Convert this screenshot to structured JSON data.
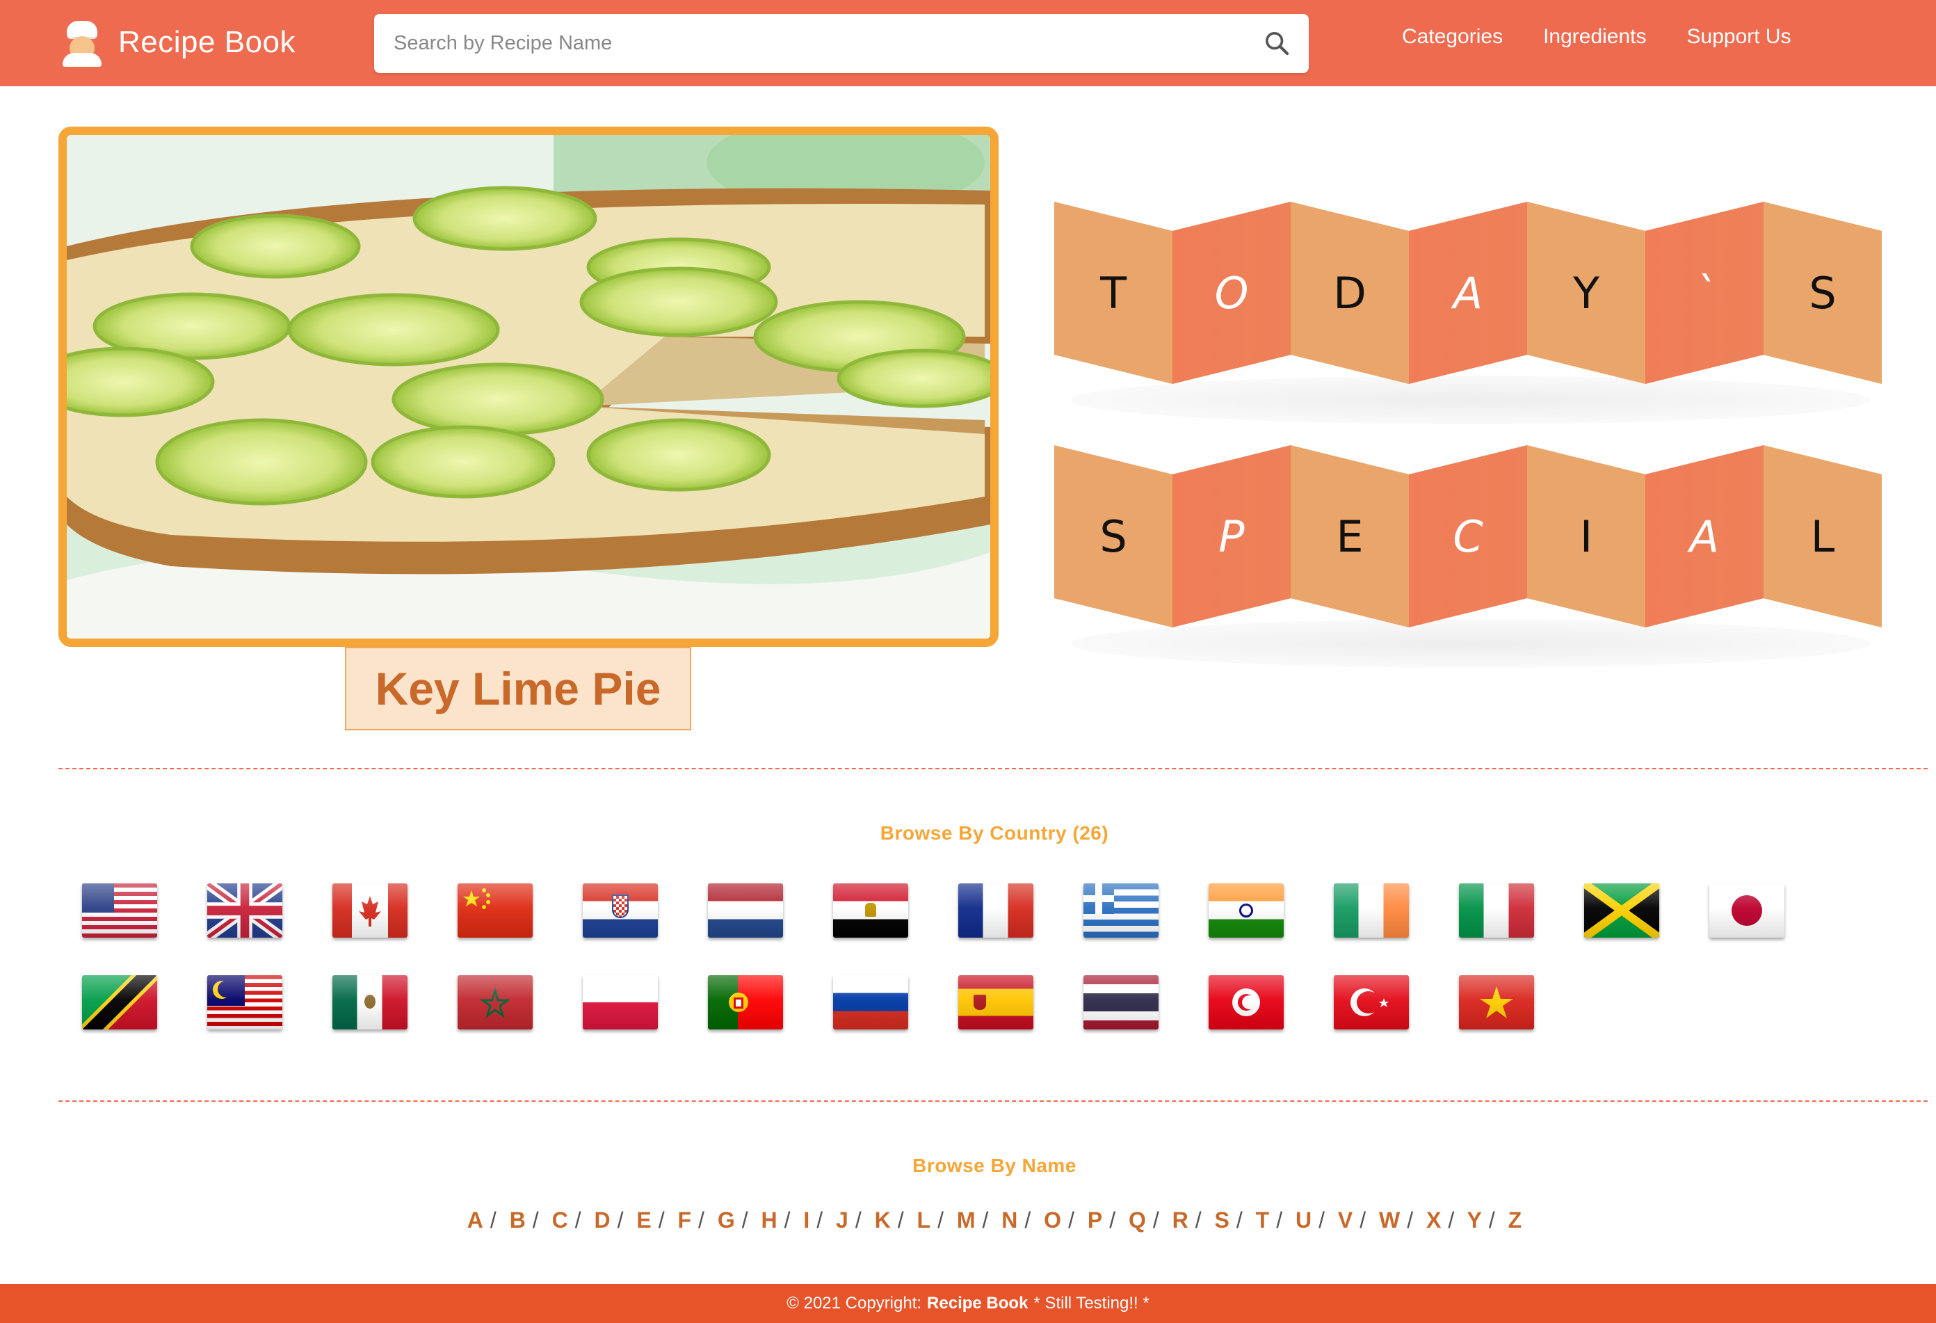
{
  "navbar": {
    "brand": "Recipe Book",
    "brand_icon": "chef-icon",
    "search_placeholder": "Search by Recipe Name",
    "links": [
      "Categories",
      "Ingredients",
      "Support Us"
    ]
  },
  "featured": {
    "title": "Key Lime Pie",
    "banner_row1": [
      "T",
      "O",
      "D",
      "A",
      "Y",
      "`",
      "S"
    ],
    "banner_row2": [
      "S",
      "P",
      "E",
      "C",
      "I",
      "A",
      "L"
    ]
  },
  "browse_country": {
    "title": "Browse By Country (26)",
    "flags": [
      "united-states",
      "united-kingdom",
      "canada",
      "china",
      "croatia",
      "netherlands",
      "egypt",
      "france",
      "greece",
      "india",
      "ireland",
      "italy",
      "jamaica",
      "japan",
      "saint-kitts-and-nevis",
      "malaysia",
      "mexico",
      "morocco",
      "poland",
      "portugal",
      "russia",
      "spain",
      "thailand",
      "tunisia",
      "turkey",
      "vietnam"
    ]
  },
  "browse_name": {
    "title": "Browse By Name",
    "letters": [
      "A",
      "B",
      "C",
      "D",
      "E",
      "F",
      "G",
      "H",
      "I",
      "J",
      "K",
      "L",
      "M",
      "N",
      "O",
      "P",
      "Q",
      "R",
      "S",
      "T",
      "U",
      "V",
      "W",
      "X",
      "Y",
      "Z"
    ]
  },
  "footer": {
    "prefix": "© 2021 Copyright:",
    "brand": "Recipe Book",
    "suffix": "* Still Testing!! *"
  },
  "colors": {
    "navbar": "#ef6b50",
    "accent": "#f5a637",
    "title_text": "#c8692a",
    "footer": "#e8542a"
  }
}
